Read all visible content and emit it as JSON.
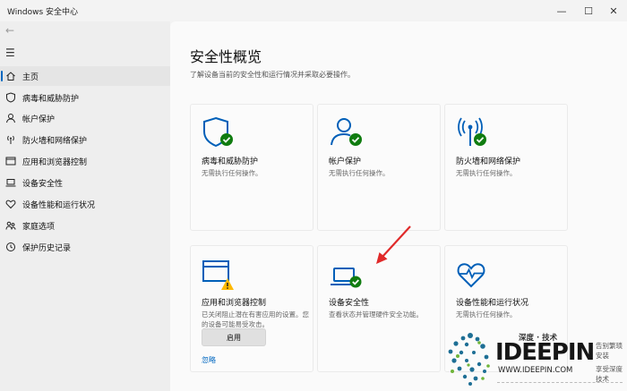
{
  "window": {
    "title": "Windows 安全中心",
    "controls": [
      "—",
      "☐",
      "✕"
    ]
  },
  "sidebar": {
    "back_icon": "back-arrow-icon",
    "menu_icon": "hamburger-icon",
    "items": [
      {
        "label": "主页",
        "icon": "home-icon",
        "active": true
      },
      {
        "label": "病毒和威胁防护",
        "icon": "shield-icon",
        "active": false
      },
      {
        "label": "帐户保护",
        "icon": "person-icon",
        "active": false
      },
      {
        "label": "防火墙和网络保护",
        "icon": "antenna-icon",
        "active": false
      },
      {
        "label": "应用和浏览器控制",
        "icon": "app-window-icon",
        "active": false
      },
      {
        "label": "设备安全性",
        "icon": "laptop-icon",
        "active": false
      },
      {
        "label": "设备性能和运行状况",
        "icon": "heart-icon",
        "active": false
      },
      {
        "label": "家庭选项",
        "icon": "family-icon",
        "active": false
      },
      {
        "label": "保护历史记录",
        "icon": "history-icon",
        "active": false
      }
    ]
  },
  "main": {
    "title": "安全性概览",
    "subtitle": "了解设备当前的安全性和运行情况并采取必要操作。",
    "cards": [
      {
        "title": "病毒和威胁防护",
        "desc": "无需执行任何操作。",
        "icon": "shield-icon",
        "status": "ok"
      },
      {
        "title": "帐户保护",
        "desc": "无需执行任何操作。",
        "icon": "person-icon",
        "status": "ok"
      },
      {
        "title": "防火墙和网络保护",
        "desc": "无需执行任何操作。",
        "icon": "antenna-icon",
        "status": "ok"
      },
      {
        "title": "应用和浏览器控制",
        "desc": "已关闭阻止潜在有害应用的设置。您的设备可能易受攻击。",
        "icon": "app-window-icon",
        "status": "warning",
        "button": "启用",
        "link": "忽略"
      },
      {
        "title": "设备安全性",
        "desc": "查看状态并管理硬件安全功能。",
        "icon": "laptop-icon",
        "status": "ok"
      },
      {
        "title": "设备性能和运行状况",
        "desc": "无需执行任何操作。",
        "icon": "heart-icon",
        "status": "none"
      }
    ]
  },
  "watermark": {
    "top": "深度 · 技术",
    "brand": "IDEEPIN",
    "url": "WWW.IDEEPIN.COM",
    "right1": "告别繁琐安装",
    "right2": "享受深度技术"
  },
  "colors": {
    "accent": "#0067c0",
    "icon_blue": "#005fb8",
    "ok_green": "#107c10",
    "warn_yellow": "#ffb900",
    "arrow_red": "#e02a2a"
  }
}
